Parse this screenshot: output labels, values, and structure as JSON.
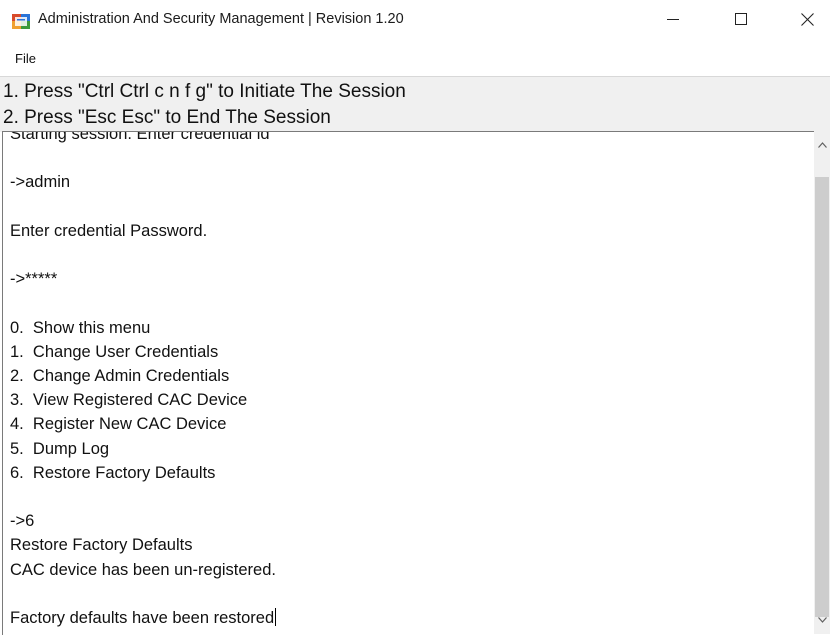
{
  "window": {
    "title": "Administration And Security Management  |  Revision 1.20",
    "icon": "app-window-icon",
    "controls": [
      "minimize-icon",
      "maximize-icon",
      "close-icon"
    ]
  },
  "menu": {
    "file_label": "File"
  },
  "instructions": {
    "line1": "1. Press \"Ctrl Ctrl c n f g\" to Initiate The Session",
    "line2": "2. Press \"Esc Esc\" to End The Session"
  },
  "console": {
    "text": "Starting session. Enter credential id\n\n->admin\n\nEnter credential Password.\n\n->*****\n\n0.  Show this menu\n1.  Change User Credentials\n2.  Change Admin Credentials\n3.  View Registered CAC Device\n4.  Register New CAC Device\n5.  Dump Log\n6.  Restore Factory Defaults\n\n->6\nRestore Factory Defaults\nCAC device has been un-registered.\n\nFactory defaults have been restored"
  }
}
